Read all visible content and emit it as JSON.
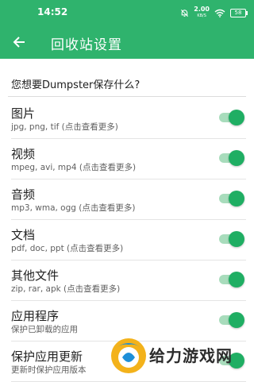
{
  "status_bar": {
    "time": "14:52",
    "net_speed_value": "2.00",
    "net_speed_unit": "KB/S",
    "battery": "58",
    "icons": [
      "alarm-off-icon",
      "wifi-icon",
      "battery-icon"
    ]
  },
  "app_bar": {
    "title": "回收站设置",
    "back_icon": "arrow-left-icon",
    "color": "#2fb36d"
  },
  "section": {
    "header": "您想要Dumpster保存什么?"
  },
  "items": [
    {
      "title": "图片",
      "subtitle": "jpg, png, tif (点击查看更多)",
      "enabled": true
    },
    {
      "title": "视频",
      "subtitle": "mpeg, avi, mp4 (点击查看更多)",
      "enabled": true
    },
    {
      "title": "音频",
      "subtitle": "mp3, wma, ogg (点击查看更多)",
      "enabled": true
    },
    {
      "title": "文档",
      "subtitle": "pdf, doc, ppt (点击查看更多)",
      "enabled": true
    },
    {
      "title": "其他文件",
      "subtitle": "zip, rar, apk (点击查看更多)",
      "enabled": true
    },
    {
      "title": "应用程序",
      "subtitle": "保护已卸载的应用",
      "enabled": true
    },
    {
      "title": "保护应用更新",
      "subtitle": "更新时保护应用版本",
      "enabled": true
    }
  ],
  "colors": {
    "accent": "#1fae63",
    "switch_track": "#a8dcbc"
  },
  "watermark": {
    "text": "给力游戏网"
  }
}
